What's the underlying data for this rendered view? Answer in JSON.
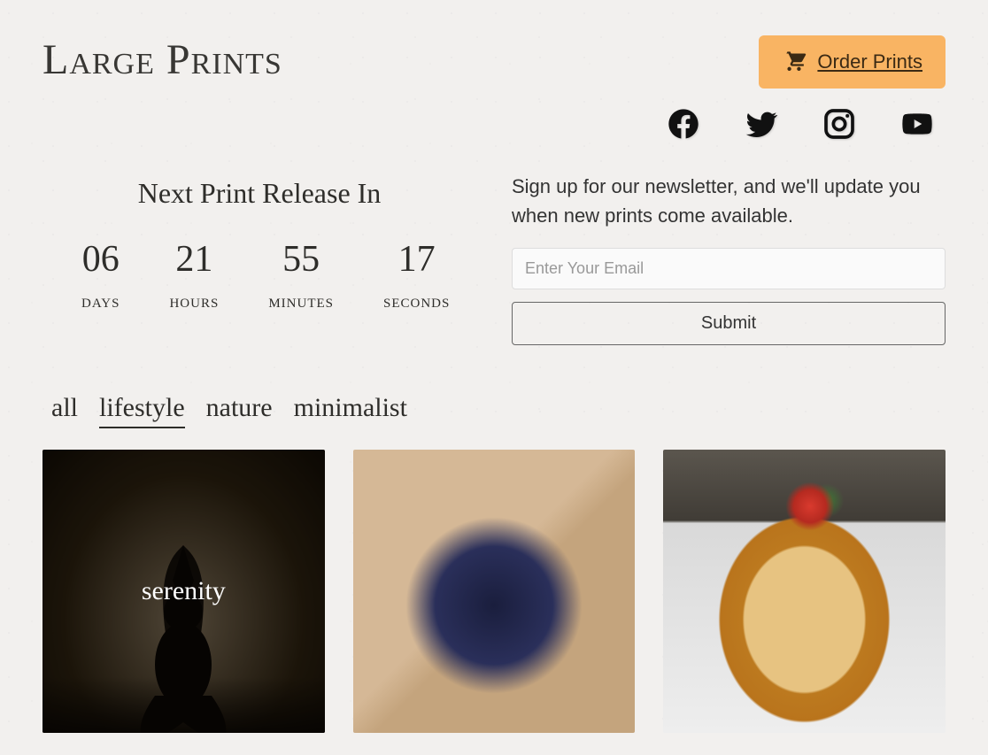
{
  "header": {
    "logo": "Large Prints",
    "order_label": "Order Prints"
  },
  "socials": {
    "facebook": "Facebook",
    "twitter": "Twitter",
    "instagram": "Instagram",
    "youtube": "YouTube"
  },
  "countdown": {
    "title": "Next Print Release In",
    "days_value": "06",
    "days_label": "DAYS",
    "hours_value": "21",
    "hours_label": "HOURS",
    "minutes_value": "55",
    "minutes_label": "MINUTES",
    "seconds_value": "17",
    "seconds_label": "SECONDS"
  },
  "newsletter": {
    "text": "Sign up for our newsletter, and we'll update you when new prints come available.",
    "placeholder": "Enter Your Email",
    "submit": "Submit"
  },
  "filters": {
    "all": "all",
    "lifestyle": "lifestyle",
    "nature": "nature",
    "minimalist": "minimalist",
    "active": "lifestyle"
  },
  "gallery": {
    "card1_label": "serenity"
  }
}
